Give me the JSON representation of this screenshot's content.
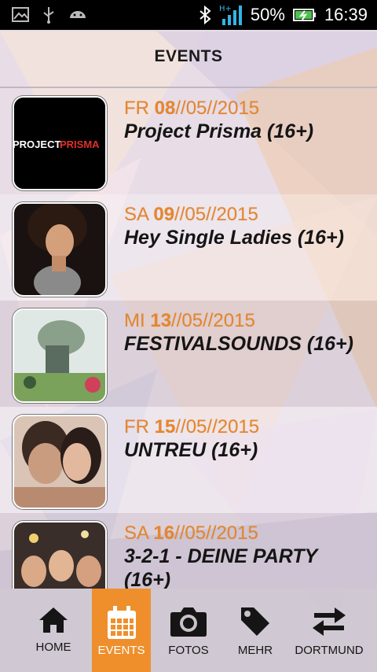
{
  "status_bar": {
    "battery_percent": "50%",
    "time": "16:39",
    "network_label": "H+"
  },
  "header": {
    "title": "EVENTS"
  },
  "events": [
    {
      "day": "FR",
      "date_bold": "08",
      "date_rest": "//05//2015",
      "title": "Project Prisma (16+)",
      "thumb_text": "PROJECT PRISMA"
    },
    {
      "day": "SA",
      "date_bold": "09",
      "date_rest": "//05//2015",
      "title": "Hey Single Ladies (16+)"
    },
    {
      "day": "MI",
      "date_bold": "13",
      "date_rest": "//05//2015",
      "title": "FESTIVALSOUNDS (16+)"
    },
    {
      "day": "FR",
      "date_bold": "15",
      "date_rest": "//05//2015",
      "title": "UNTREU (16+)"
    },
    {
      "day": "SA",
      "date_bold": "16",
      "date_rest": "//05//2015",
      "title": "3-2-1 - DEINE PARTY (16+)"
    }
  ],
  "nav": {
    "items": [
      {
        "label": "HOME",
        "icon": "home-icon"
      },
      {
        "label": "EVENTS",
        "icon": "calendar-icon",
        "active": true
      },
      {
        "label": "FOTOS",
        "icon": "camera-icon"
      },
      {
        "label": "MEHR",
        "icon": "tag-icon"
      },
      {
        "label": "DORTMUND",
        "icon": "swap-icon"
      }
    ]
  },
  "colors": {
    "accent": "#ef8f2c",
    "date": "#e6862d"
  }
}
